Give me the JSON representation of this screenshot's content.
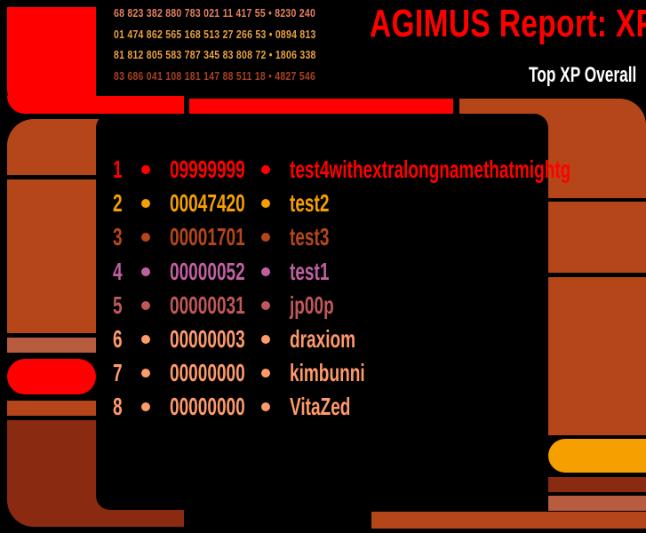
{
  "header": {
    "title": "AGIMUS Report: XP",
    "subtitle": "Top XP Overall",
    "number_rows": [
      {
        "text": "68 823 382 880 783 021 11 417 55 • 8230 240",
        "color": "#e08060"
      },
      {
        "text": "01 474 862 565 168 513 27 266 53 • 0894 813",
        "color": "#e8a040"
      },
      {
        "text": "81 812 805 583 787 345 83 808 72 • 1806 338",
        "color": "#e8a040"
      },
      {
        "text": "83 686 041 108 181 147 88 511 18 • 4827 546",
        "color": "#a84020"
      }
    ]
  },
  "colors": {
    "red": "#ff0000",
    "orange": "#f59f00",
    "rust": "#b5461a",
    "brown": "#8a2a10",
    "dusty": "#b85c40",
    "salmon": "#ff9a6a",
    "pink": "#c060a0"
  },
  "leaderboard": [
    {
      "rank": "1",
      "xp": "09999999",
      "name": "test4withextralongnamethatmightg",
      "color": "#ff0000"
    },
    {
      "rank": "2",
      "xp": "00047420",
      "name": "test2",
      "color": "#f59f00"
    },
    {
      "rank": "3",
      "xp": "00001701",
      "name": "test3",
      "color": "#b5461a"
    },
    {
      "rank": "4",
      "xp": "00000052",
      "name": "test1",
      "color": "#c060a0"
    },
    {
      "rank": "5",
      "xp": "00000031",
      "name": "jp00p",
      "color": "#c0585a"
    },
    {
      "rank": "6",
      "xp": "00000003",
      "name": "draxiom",
      "color": "#ff9a6a"
    },
    {
      "rank": "7",
      "xp": "00000000",
      "name": "kimbunni",
      "color": "#ff9a6a"
    },
    {
      "rank": "8",
      "xp": "00000000",
      "name": "VitaZed",
      "color": "#ff9a6a"
    }
  ]
}
